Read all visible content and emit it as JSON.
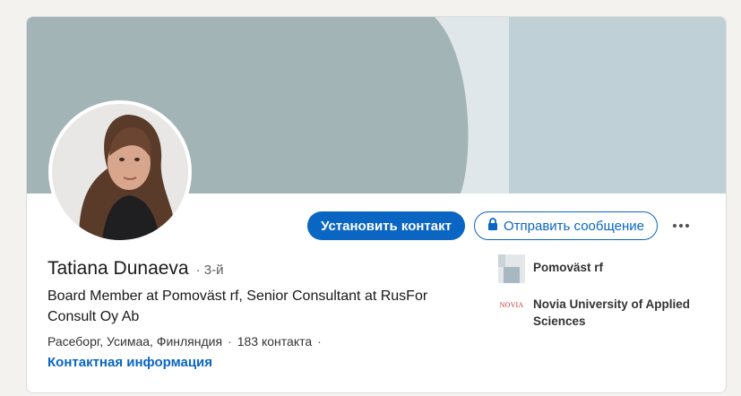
{
  "profile": {
    "name": "Tatiana Dunaeva",
    "degree": "· 3-й",
    "headline": "Board Member at Pomoväst rf, Senior Consultant at RusFor Consult Oy Ab",
    "location": "Расеборг, Усимаа, Финляндия",
    "connections": "183 контакта",
    "contact_info": "Контактная информация"
  },
  "actions": {
    "connect_label": "Установить контакт",
    "message_label": "Отправить сообщение",
    "more_label": "···"
  },
  "organizations": [
    {
      "name": "Pomoväst rf",
      "logo_icon": "company-logo-icon"
    },
    {
      "name": "Novia University of Applied Sciences",
      "logo_text": "NOVIA"
    }
  ],
  "colors": {
    "accent": "#0a66c2",
    "cover_dark": "#a3b4b7",
    "cover_light": "#dfe7ea",
    "cover_right": "#bfd1d6"
  },
  "separators": {
    "dot": "·"
  }
}
